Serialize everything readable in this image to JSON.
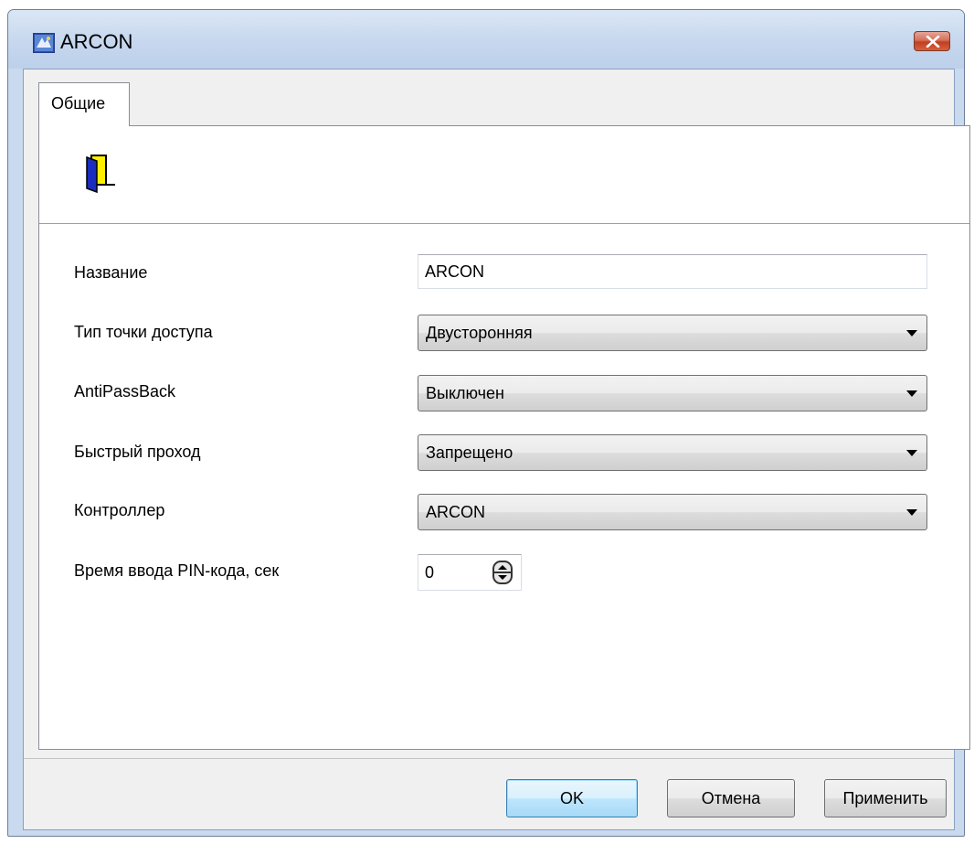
{
  "window": {
    "title": "ARCON"
  },
  "tabs": [
    {
      "label": "Общие"
    }
  ],
  "form": {
    "name": {
      "label": "Название",
      "value": "ARCON"
    },
    "access_point_type": {
      "label": "Тип точки доступа",
      "value": "Двусторонняя"
    },
    "antipassback": {
      "label": "AntiPassBack",
      "value": "Выключен"
    },
    "fast_pass": {
      "label": "Быстрый проход",
      "value": "Запрещено"
    },
    "controller": {
      "label": "Контроллер",
      "value": "ARCON"
    },
    "pin_time": {
      "label": "Время ввода PIN-кода, сек",
      "value": "0"
    }
  },
  "buttons": {
    "ok": "OK",
    "cancel": "Отмена",
    "apply": "Применить"
  },
  "icons": {
    "app": "arcon-app-icon",
    "close": "close-icon",
    "door": "door-icon",
    "dropdown": "chevron-down-icon",
    "spin": "spin-updown-icon"
  },
  "colors": {
    "titlebar": "#c6d7ee",
    "close_button": "#c0401f",
    "door_yellow": "#ffee00",
    "door_blue": "#1a2dbe",
    "default_button": "#bee6fd"
  }
}
